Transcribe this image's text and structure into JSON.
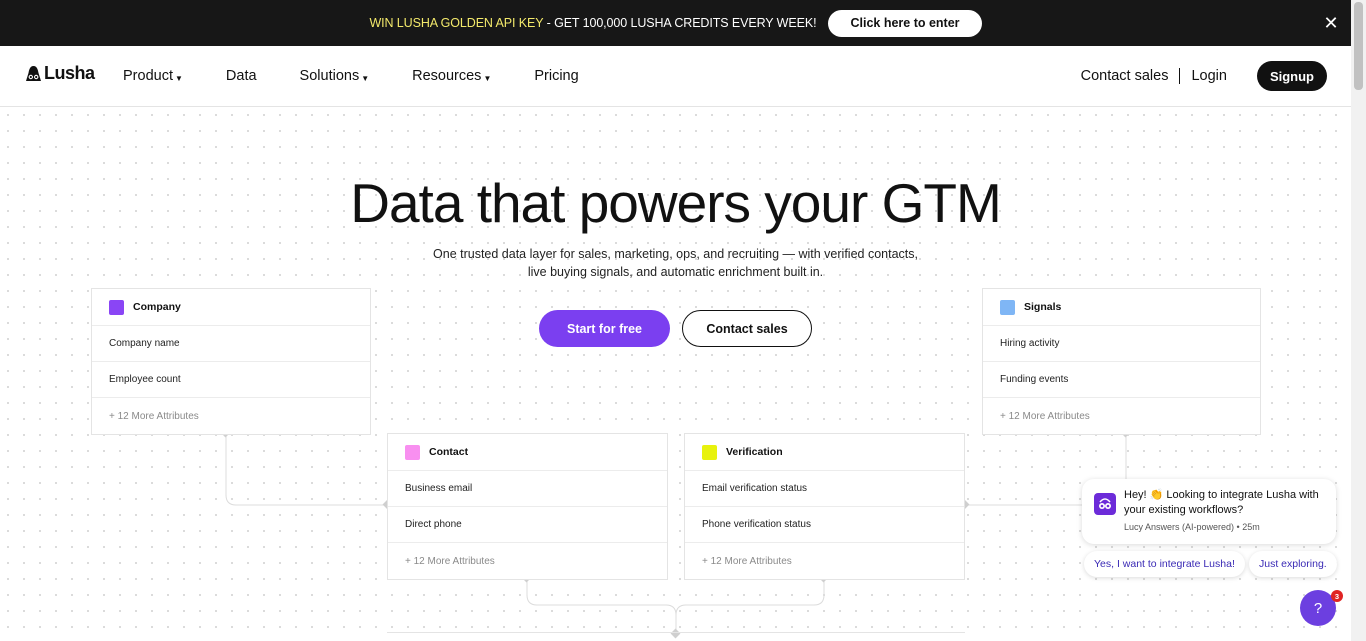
{
  "promo": {
    "highlight": "WIN LUSHA GOLDEN API KEY",
    "text": " - GET 100,000 LUSHA CREDITS EVERY WEEK!",
    "button": "Click here to enter",
    "close": "✕"
  },
  "nav": {
    "logo": "Lusha",
    "items": [
      {
        "label": "Product",
        "dropdown": true
      },
      {
        "label": "Data",
        "dropdown": false
      },
      {
        "label": "Solutions",
        "dropdown": true
      },
      {
        "label": "Resources",
        "dropdown": true
      },
      {
        "label": "Pricing",
        "dropdown": false
      }
    ],
    "contact_sales": "Contact sales",
    "login": "Login",
    "signup": "Signup"
  },
  "hero": {
    "title": "Data that powers your GTM",
    "subtitle_line1": "One trusted data layer for sales, marketing, ops, and recruiting — with verified contacts,",
    "subtitle_line2": "live buying signals, and automatic enrichment built in.",
    "cta_primary": "Start for free",
    "cta_secondary": "Contact sales"
  },
  "cards": {
    "company": {
      "title": "Company",
      "color": "#8a45f5",
      "rows": [
        "Company name",
        "Employee count"
      ],
      "more": "+ 12 More Attributes"
    },
    "signals": {
      "title": "Signals",
      "color": "#7fb6f5",
      "rows": [
        "Hiring activity",
        "Funding events"
      ],
      "more": "+ 12 More Attributes"
    },
    "contact": {
      "title": "Contact",
      "color": "#f88ff0",
      "rows": [
        "Business email",
        "Direct phone"
      ],
      "more": "+ 12 More Attributes"
    },
    "verification": {
      "title": "Verification",
      "color": "#e8f20d",
      "rows": [
        "Email verification status",
        "Phone verification status"
      ],
      "more": "+ 12 More Attributes"
    }
  },
  "chat": {
    "message": "Hey! 👏 Looking to integrate Lusha with your existing workflows?",
    "meta": "Lucy Answers (AI-powered) • 25m",
    "reply_1": "Yes, I want to integrate Lusha!",
    "reply_2": "Just exploring.",
    "help": "?",
    "badge": "3"
  }
}
